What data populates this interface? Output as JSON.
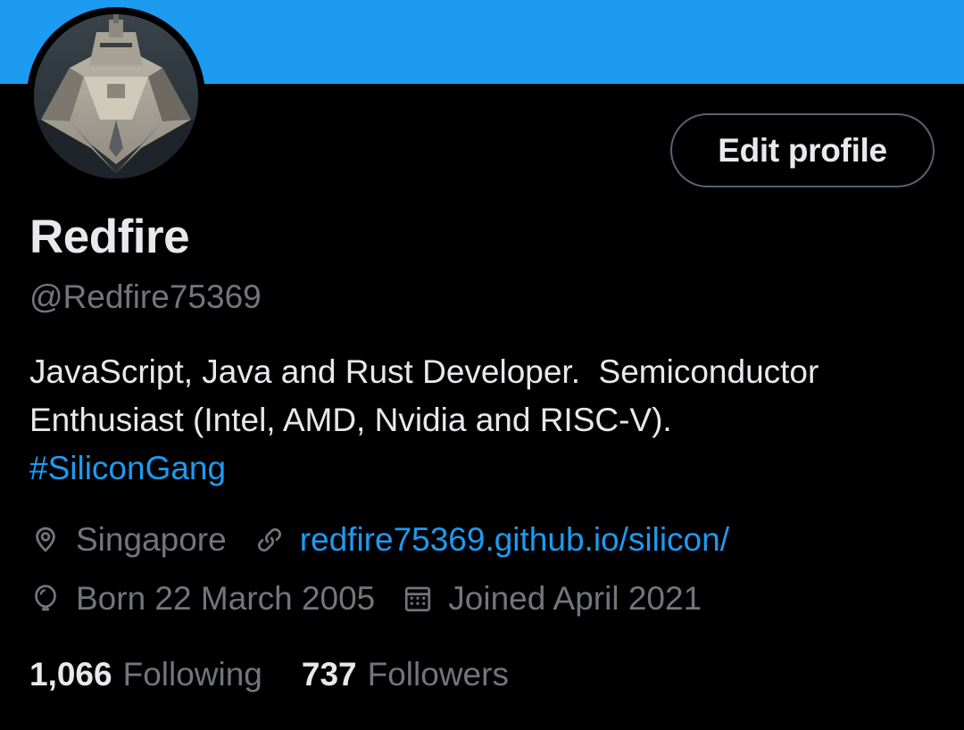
{
  "profile": {
    "display_name": "Redfire",
    "handle": "@Redfire75369",
    "edit_button_label": "Edit profile",
    "avatar_alt": "ship-avatar",
    "bio": {
      "line1": "JavaScript, Java and Rust Developer.  Semiconductor",
      "line2": "Enthusiast (Intel, AMD, Nvidia and RISC-V).",
      "hashtag": "#SiliconGang"
    },
    "location": "Singapore",
    "website": "redfire75369.github.io/silicon/",
    "birthday": "Born 22 March 2005",
    "joined": "Joined April 2021",
    "following_count": "1,066",
    "following_label": "Following",
    "followers_count": "737",
    "followers_label": "Followers"
  },
  "icons": {
    "location": "location-pin-icon",
    "link": "link-icon",
    "birthday": "balloon-icon",
    "joined": "calendar-icon"
  },
  "colors": {
    "background": "#000000",
    "banner": "#1d9bf0",
    "accent": "#1d9bf0",
    "primary_text": "#e7e9ea",
    "secondary_text": "#71767b",
    "button_border": "#536471"
  }
}
